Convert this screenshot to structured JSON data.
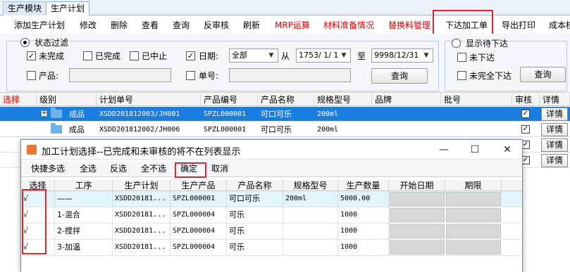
{
  "module_tabs": [
    "生产模块",
    "生产计划"
  ],
  "toolbar": {
    "add": "添加生产计划",
    "edit": "修改",
    "delete": "删除",
    "view": "查看",
    "query": "查询",
    "unaudit": "反审核",
    "refresh": "刷新",
    "mrp": "MRP运算",
    "material_prep": "材料准备情况",
    "substitute": "替换料管理",
    "issue_order": "下达加工单",
    "export_print": "导出打印",
    "cost": "成本核"
  },
  "filter": {
    "status_filter": "状态过滤",
    "unfinished": "未完成",
    "finished": "已完成",
    "stopped": "已中止",
    "date_label": "日期:",
    "date_option": "全部",
    "from": "从",
    "date_from": "1753/ 1/ 1",
    "to": "至",
    "date_to": "9998/12/31",
    "product_label": "产品:",
    "order_label": "单号:",
    "query_button": "查询",
    "show_pending": "显示待下达",
    "not_issued": "未下达",
    "not_fully_issued": "未完全下达",
    "query_button2": "查询"
  },
  "grid": {
    "headers": [
      "选择",
      "级别",
      "计划单号",
      "产品编号",
      "产品名称",
      "规格型号",
      "品牌",
      "批号",
      "审核",
      "详情"
    ],
    "rows": [
      {
        "level": "成品",
        "plan_no": "XSDD201812003/JH001",
        "product_code": "SPZL000001",
        "product_name": "可口可乐",
        "spec": "200ml",
        "audited": "✓",
        "detail": "详情"
      },
      {
        "level": "成品",
        "plan_no": "XSDD201812002/JH006",
        "product_code": "SPZL000001",
        "product_name": "可口可乐",
        "spec": "200ml",
        "audited": "✓",
        "detail": "详情"
      },
      {
        "audited": "✓",
        "detail": "详情"
      },
      {
        "audited": "✓",
        "detail": "详情"
      }
    ]
  },
  "dialog": {
    "title": "加工计划选择--已完成和未审核的将不在列表显示",
    "buttons": {
      "quick_multi": "快捷多选",
      "select_all": "全选",
      "invert": "反选",
      "select_none": "全不选",
      "confirm": "确定",
      "cancel": "取消"
    },
    "headers": [
      "选择",
      "工序",
      "生产计划",
      "生产产品",
      "产品名称",
      "规格型号",
      "生产数量",
      "开始日期",
      "期限"
    ],
    "rows": [
      {
        "check": "√",
        "process": "——",
        "plan": "XSDD20181...",
        "product": "SPZL000001",
        "name": "可口可乐",
        "spec": "200ml",
        "qty": "5000.00"
      },
      {
        "check": "√",
        "process": "1-混合",
        "plan": "XSDD20181...",
        "product": "SPZL000004",
        "name": "可乐",
        "spec": "",
        "qty": "1000"
      },
      {
        "check": "√",
        "process": "2-搅拌",
        "plan": "XSDD20181...",
        "product": "SPZL000004",
        "name": "可乐",
        "spec": "",
        "qty": "1000"
      },
      {
        "check": "√",
        "process": "3-加温",
        "plan": "XSDD20181...",
        "product": "SPZL000004",
        "name": "可乐",
        "spec": "",
        "qty": "1000"
      }
    ]
  },
  "colors": {
    "accent_red": "#e00000",
    "selected_row": "#1a7de0",
    "highlight_box": "#e0242b"
  }
}
